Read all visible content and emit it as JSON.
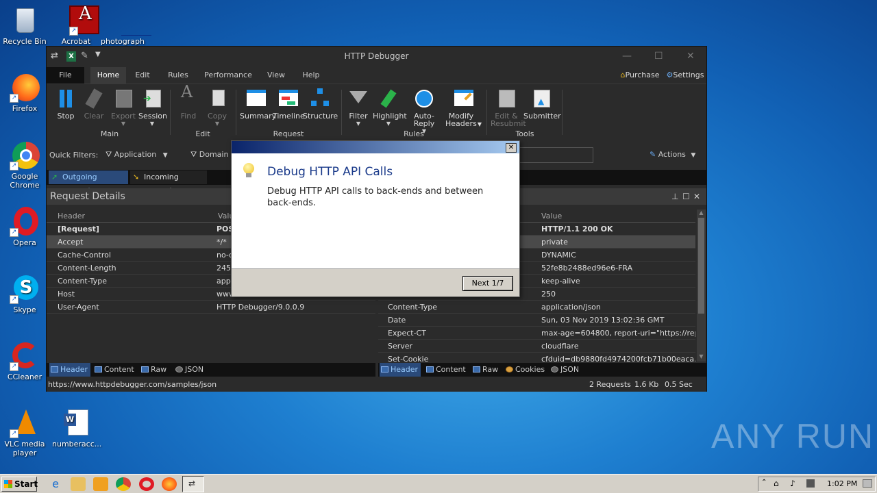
{
  "desktop": {
    "icons": [
      {
        "label": "Recycle Bin",
        "icon": "recycle-bin-icon"
      },
      {
        "label": "Acrobat",
        "icon": "acrobat-icon"
      },
      {
        "label": "photograph",
        "icon": "image-file-icon"
      },
      {
        "label": "Firefox",
        "icon": "firefox-icon"
      },
      {
        "label": "Google Chrome",
        "icon": "chrome-icon"
      },
      {
        "label": "Opera",
        "icon": "opera-icon"
      },
      {
        "label": "Skype",
        "icon": "skype-icon"
      },
      {
        "label": "CCleaner",
        "icon": "ccleaner-icon"
      },
      {
        "label": "VLC media player",
        "icon": "vlc-icon"
      },
      {
        "label": "numberacc...",
        "icon": "word-document-icon"
      }
    ],
    "watermark": "ANY RUN"
  },
  "window": {
    "title": "HTTP Debugger",
    "menu": [
      "File",
      "Home",
      "Edit",
      "Rules",
      "Performance",
      "View",
      "Help"
    ],
    "purchase": "Purchase",
    "settings": "Settings",
    "ribbon": {
      "main": {
        "label": "Main",
        "buttons": [
          "Stop",
          "Clear",
          "Export",
          "Session"
        ]
      },
      "edit": {
        "label": "Edit",
        "buttons": [
          "Find",
          "Copy"
        ]
      },
      "request": {
        "label": "Request",
        "buttons": [
          "Summary",
          "Timeline",
          "Structure"
        ]
      },
      "rules": {
        "label": "Rules",
        "buttons": [
          "Filter",
          "Highlight",
          "Auto-Reply",
          "Modify Headers"
        ]
      },
      "tools": {
        "label": "Tools",
        "buttons": [
          "Edit & Resubmit",
          "Submitter"
        ]
      }
    },
    "quick_filters": {
      "label": "Quick Filters:",
      "application": "Application",
      "domain": "Domain",
      "actions": "Actions"
    },
    "req_tabs": {
      "outgoing": "Outgoing requests",
      "incoming": "Incoming requests"
    },
    "request_details": {
      "title": "Request Details",
      "col_header": "Header",
      "col_value": "Valu",
      "rows": [
        {
          "h": "[Request]",
          "v": "POS"
        },
        {
          "h": "Accept",
          "v": "*/*"
        },
        {
          "h": "Cache-Control",
          "v": "no-c"
        },
        {
          "h": "Content-Length",
          "v": "245"
        },
        {
          "h": "Content-Type",
          "v": "appl"
        },
        {
          "h": "Host",
          "v": "www."
        },
        {
          "h": "User-Agent",
          "v": "HTTP Debugger/9.0.0.9"
        }
      ],
      "tabs": [
        "Header",
        "Content",
        "Raw",
        "JSON"
      ]
    },
    "response_details": {
      "col_value": "Value",
      "rows": [
        {
          "h": "",
          "v": "HTTP/1.1 200 OK"
        },
        {
          "h": "",
          "v": "private"
        },
        {
          "h": "",
          "v": "DYNAMIC"
        },
        {
          "h": "",
          "v": "52fe8b2488ed96e6-FRA"
        },
        {
          "h": "",
          "v": "keep-alive"
        },
        {
          "h": "",
          "v": "250"
        },
        {
          "h": "Content-Type",
          "v": "application/json"
        },
        {
          "h": "Date",
          "v": "Sun, 03 Nov 2019 13:02:36 GMT"
        },
        {
          "h": "Expect-CT",
          "v": "max-age=604800, report-uri=\"https://rep..."
        },
        {
          "h": "Server",
          "v": "cloudflare"
        },
        {
          "h": "Set-Cookie",
          "v": "cfduid=db9880fd4974200fcb71b00eaca..."
        }
      ],
      "tabs": [
        "Header",
        "Content",
        "Raw",
        "Cookies",
        "JSON"
      ]
    },
    "status": {
      "url": "https://www.httpdebugger.com/samples/json",
      "requests": "2 Requests",
      "size": "1.6 Kb",
      "time": "0.5 Sec"
    }
  },
  "dialog": {
    "title": "Debug HTTP API Calls",
    "body": "Debug HTTP API calls to back-ends and between back-ends.",
    "next": "Next 1/7",
    "close": "✕"
  },
  "taskbar": {
    "start": "Start",
    "clock": "1:02 PM"
  }
}
